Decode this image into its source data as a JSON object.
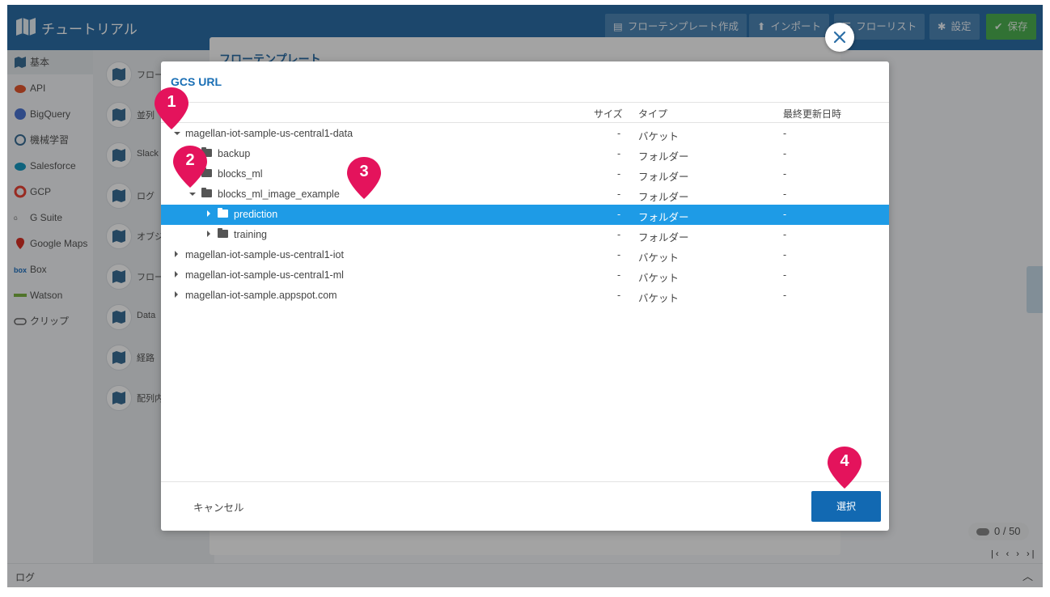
{
  "app": {
    "title": "チュートリアル"
  },
  "header": {
    "buttons": {
      "template_create": "フローテンプレート作成",
      "import": "インポート",
      "flow_list": "フローリスト",
      "settings": "設定",
      "save": "保存"
    }
  },
  "sidebar": {
    "items": [
      {
        "label": "基本",
        "icon": "magellan-icon"
      },
      {
        "label": "API",
        "icon": "api-icon"
      },
      {
        "label": "BigQuery",
        "icon": "bigquery-icon"
      },
      {
        "label": "機械学習",
        "icon": "brain-icon"
      },
      {
        "label": "Salesforce",
        "icon": "salesforce-icon"
      },
      {
        "label": "GCP",
        "icon": "gcp-icon"
      },
      {
        "label": "G Suite",
        "icon": "gsuite-icon"
      },
      {
        "label": "Google Maps",
        "icon": "maps-pin-icon"
      },
      {
        "label": "Box",
        "icon": "box-icon"
      },
      {
        "label": "Watson",
        "icon": "watson-icon"
      },
      {
        "label": "クリップ",
        "icon": "clip-icon"
      }
    ]
  },
  "blocks": [
    {
      "label": "フロー"
    },
    {
      "label": "並列"
    },
    {
      "label": "Slack"
    },
    {
      "label": "ログ"
    },
    {
      "label": "オブジ"
    },
    {
      "label": "フロー"
    },
    {
      "label": "Data"
    },
    {
      "label": "経路"
    },
    {
      "label": "配列内"
    }
  ],
  "background_panel": {
    "title": "フローテンプレート"
  },
  "bottom": {
    "counter": "0 / 50",
    "log_label": "ログ"
  },
  "modal": {
    "title": "GCS URL",
    "columns": {
      "size": "サイズ",
      "type": "タイプ",
      "modified": "最終更新日時"
    },
    "rows": [
      {
        "name": "magellan-iot-sample-us-central1-data",
        "size": "-",
        "type": "バケット",
        "modified": "-"
      },
      {
        "name": "backup",
        "size": "-",
        "type": "フォルダー",
        "modified": "-"
      },
      {
        "name": "blocks_ml",
        "size": "-",
        "type": "フォルダー",
        "modified": "-"
      },
      {
        "name": "blocks_ml_image_example",
        "size": "-",
        "type": "フォルダー",
        "modified": "-"
      },
      {
        "name": "prediction",
        "size": "-",
        "type": "フォルダー",
        "modified": "-"
      },
      {
        "name": "training",
        "size": "-",
        "type": "フォルダー",
        "modified": "-"
      },
      {
        "name": "magellan-iot-sample-us-central1-iot",
        "size": "-",
        "type": "バケット",
        "modified": "-"
      },
      {
        "name": "magellan-iot-sample-us-central1-ml",
        "size": "-",
        "type": "バケット",
        "modified": "-"
      },
      {
        "name": "magellan-iot-sample.appspot.com",
        "size": "-",
        "type": "バケット",
        "modified": "-"
      }
    ],
    "cancel_label": "キャンセル",
    "select_label": "選択"
  },
  "markers": [
    "1",
    "2",
    "3",
    "4"
  ],
  "colors": {
    "header": "#2b6ea6",
    "accent": "#1e9be6",
    "marker": "#e4135c",
    "save": "#4caf50"
  }
}
